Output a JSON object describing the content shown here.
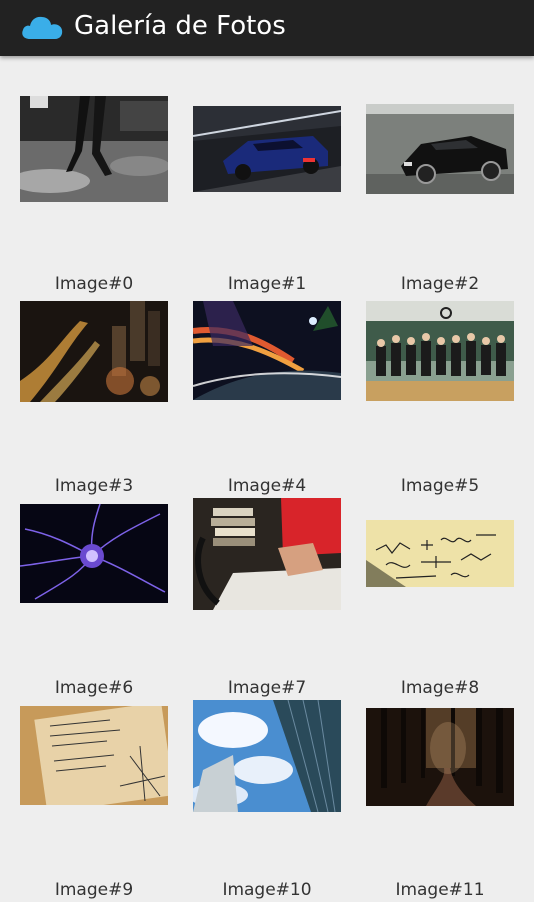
{
  "app": {
    "title": "Galería de Fotos",
    "icon": "cloud-icon",
    "bar_color": "#222222",
    "icon_color": "#3aaee8"
  },
  "gallery": {
    "items": [
      {
        "caption": "Image#0",
        "subject": "dancer legs on stage"
      },
      {
        "caption": "Image#1",
        "subject": "blue muscle car in tunnel"
      },
      {
        "caption": "Image#2",
        "subject": "black sedan by wall"
      },
      {
        "caption": "Image#3",
        "subject": "city at night aerial"
      },
      {
        "caption": "Image#4",
        "subject": "light trails on road"
      },
      {
        "caption": "Image#5",
        "subject": "class group photo"
      },
      {
        "caption": "Image#6",
        "subject": "plasma ball"
      },
      {
        "caption": "Image#7",
        "subject": "student at desk with books"
      },
      {
        "caption": "Image#8",
        "subject": "handwritten equations"
      },
      {
        "caption": "Image#9",
        "subject": "math notes and graph"
      },
      {
        "caption": "Image#10",
        "subject": "skyscrapers and sky"
      },
      {
        "caption": "Image#11",
        "subject": "forest path"
      }
    ]
  }
}
